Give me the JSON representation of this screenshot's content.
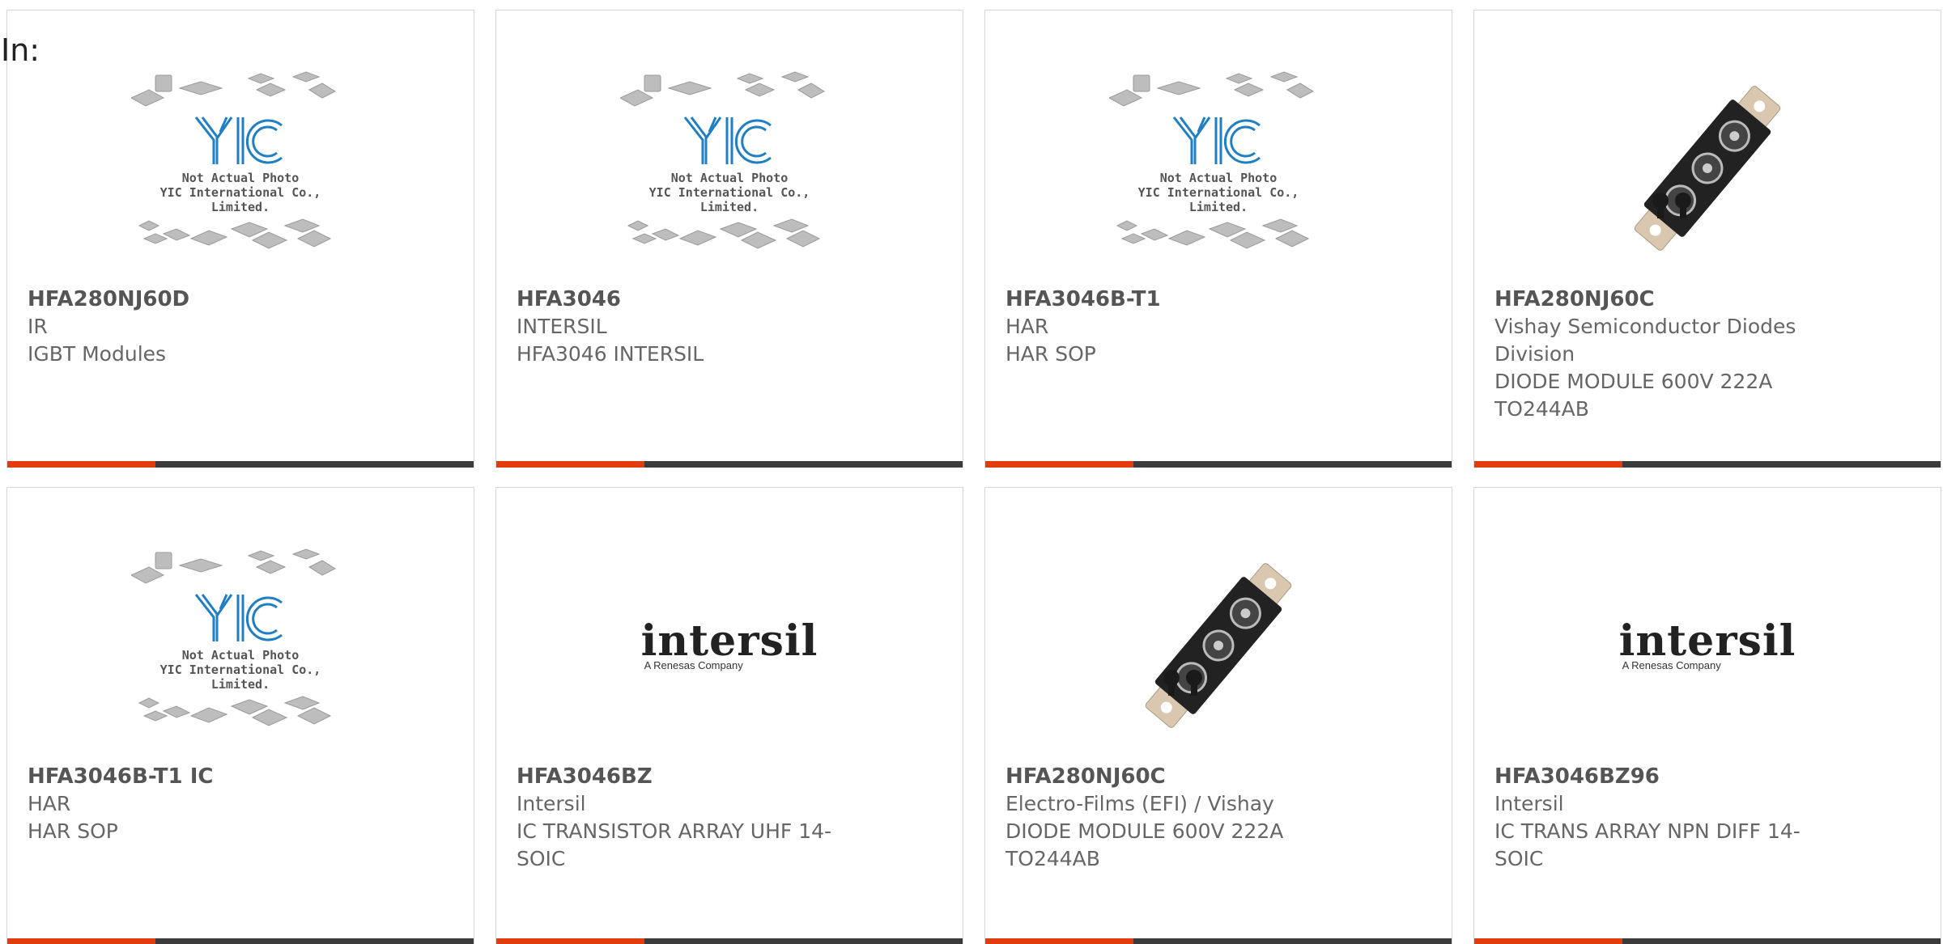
{
  "header": {
    "label": "In:"
  },
  "products": [
    {
      "part": "HFA280NJ60D",
      "manufacturer": "IR",
      "description": "IGBT Modules",
      "image": "yic-placeholder",
      "image_caption_1": "Not Actual Photo",
      "image_caption_2": "YIC International Co., Limited."
    },
    {
      "part": "HFA3046",
      "manufacturer": "INTERSIL",
      "description": "HFA3046 INTERSIL",
      "image": "yic-placeholder",
      "image_caption_1": "Not Actual Photo",
      "image_caption_2": "YIC International Co., Limited."
    },
    {
      "part": "HFA3046B-T1",
      "manufacturer": "HAR",
      "description": "HAR SOP",
      "image": "yic-placeholder",
      "image_caption_1": "Not Actual Photo",
      "image_caption_2": "YIC International Co., Limited."
    },
    {
      "part": "HFA280NJ60C",
      "manufacturer": "Vishay Semiconductor Diodes Division",
      "description": "DIODE MODULE 600V 222A TO244AB",
      "image": "diode-module-photo"
    },
    {
      "part": "HFA3046B-T1 IC",
      "manufacturer": "HAR",
      "description": "HAR SOP",
      "image": "yic-placeholder",
      "image_caption_1": "Not Actual Photo",
      "image_caption_2": "YIC International Co., Limited."
    },
    {
      "part": "HFA3046BZ",
      "manufacturer": "Intersil",
      "description": "IC TRANSISTOR ARRAY UHF 14-SOIC",
      "image": "intersil-logo",
      "logo_word": "intersil",
      "logo_sub": "A Renesas Company"
    },
    {
      "part": "HFA280NJ60C",
      "manufacturer": "Electro-Films (EFI) / Vishay",
      "description": "DIODE MODULE 600V 222A TO244AB",
      "image": "diode-module-photo"
    },
    {
      "part": "HFA3046BZ96",
      "manufacturer": "Intersil",
      "description": "IC TRANS ARRAY NPN DIFF 14-SOIC",
      "image": "intersil-logo",
      "logo_word": "intersil",
      "logo_sub": "A Renesas Company"
    }
  ],
  "colors": {
    "accent": "#e23c0e",
    "bar": "#3b3b3b",
    "yic_blue": "#1f7fc4"
  }
}
